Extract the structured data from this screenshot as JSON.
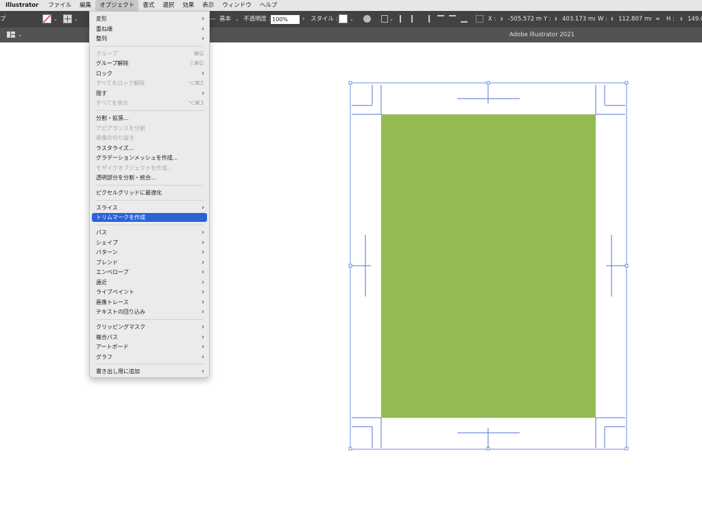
{
  "menubar": {
    "app_name": "Illustrator",
    "items": [
      "ファイル",
      "編集",
      "オブジェクト",
      "書式",
      "選択",
      "効果",
      "表示",
      "ウィンドウ",
      "ヘルプ"
    ]
  },
  "controlbar": {
    "left_fragment": "プ",
    "stroke_style": "基本",
    "opacity_label": "不透明度 :",
    "opacity_value": "100%",
    "style_label": "スタイル :",
    "x_label": "X :",
    "x_value": "-505.572 m",
    "y_label": "Y :",
    "y_value": "403.173 mı",
    "w_label": "W :",
    "w_value": "112.807 mı",
    "h_label": "H :",
    "h_value": "149.0"
  },
  "tabbar": {
    "window_title": "Adobe Illustrator 2021"
  },
  "object_menu": {
    "items": [
      {
        "label": "変形",
        "submenu": true
      },
      {
        "label": "重ね順",
        "submenu": true
      },
      {
        "label": "整列",
        "submenu": true
      },
      {
        "label": "グループ",
        "shortcut": "⌘G",
        "disabled": true
      },
      {
        "label": "グループ解除",
        "shortcut": "⇧⌘G"
      },
      {
        "label": "ロック",
        "submenu": true
      },
      {
        "label": "すべてをロック解除",
        "shortcut": "⌥⌘2",
        "disabled": true
      },
      {
        "label": "隠す",
        "submenu": true
      },
      {
        "label": "すべてを表示",
        "shortcut": "⌥⌘3",
        "disabled": true
      },
      {
        "label": "分割・拡張..."
      },
      {
        "label": "アピアランスを分割",
        "disabled": true
      },
      {
        "label": "画像の切り抜き",
        "disabled": true
      },
      {
        "label": "ラスタライズ..."
      },
      {
        "label": "グラデーションメッシュを作成..."
      },
      {
        "label": "モザイクオブジェクトを作成...",
        "disabled": true
      },
      {
        "label": "透明部分を分割・統合..."
      },
      {
        "label": "ピクセルグリッドに最適化"
      },
      {
        "label": "スライス",
        "submenu": true
      },
      {
        "label": "トリムマークを作成",
        "highlighted": true
      },
      {
        "label": "パス",
        "submenu": true
      },
      {
        "label": "シェイプ",
        "submenu": true
      },
      {
        "label": "パターン",
        "submenu": true
      },
      {
        "label": "ブレンド",
        "submenu": true
      },
      {
        "label": "エンベロープ",
        "submenu": true
      },
      {
        "label": "遠近",
        "submenu": true
      },
      {
        "label": "ライブペイント",
        "submenu": true
      },
      {
        "label": "画像トレース",
        "submenu": true
      },
      {
        "label": "テキストの回り込み",
        "submenu": true
      },
      {
        "label": "クリッピングマスク",
        "submenu": true
      },
      {
        "label": "複合パス",
        "submenu": true
      },
      {
        "label": "アートボード",
        "submenu": true
      },
      {
        "label": "グラフ",
        "submenu": true
      },
      {
        "label": "書き出し用に追加",
        "submenu": true
      }
    ]
  },
  "artwork": {
    "fill_color": "#93ba53",
    "selection_color": "#6e8ee6",
    "trim_mark_color": "#4d72d8"
  },
  "icons": {
    "submenu": "chevron-right-icon",
    "fill_swatch": "no-fill-icon",
    "workspace": "workspace-switcher-icon"
  }
}
